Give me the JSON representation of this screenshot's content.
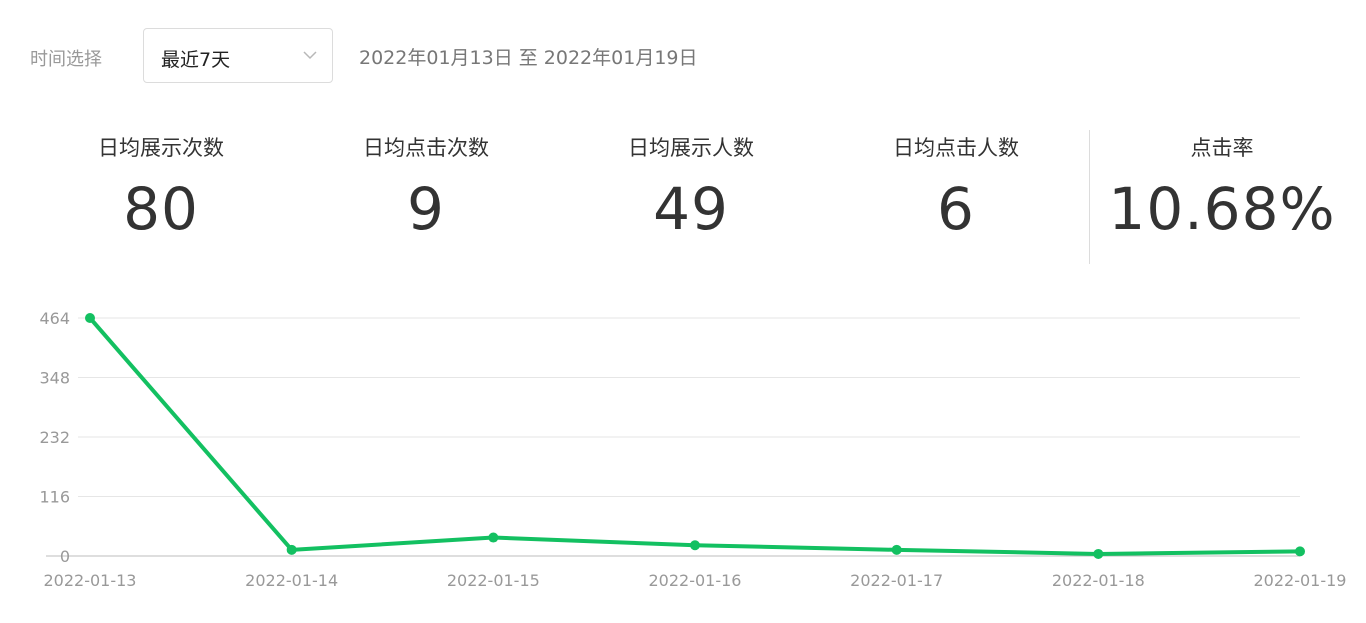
{
  "filter": {
    "label": "时间选择",
    "selected": "最近7天",
    "date_range": "2022年01月13日 至 2022年01月19日"
  },
  "stats": [
    {
      "label": "日均展示次数",
      "value": "80"
    },
    {
      "label": "日均点击次数",
      "value": "9"
    },
    {
      "label": "日均展示人数",
      "value": "49"
    },
    {
      "label": "日均点击人数",
      "value": "6"
    },
    {
      "label": "点击率",
      "value": "10.68%"
    }
  ],
  "colors": {
    "line": "#13c061",
    "grid": "#e6e6e6",
    "axis_text": "#999999"
  },
  "chart_data": {
    "type": "line",
    "x": [
      "2022-01-13",
      "2022-01-14",
      "2022-01-15",
      "2022-01-16",
      "2022-01-17",
      "2022-01-18",
      "2022-01-19"
    ],
    "series": [
      {
        "values": [
          464,
          12,
          36,
          21,
          12,
          4,
          9
        ]
      }
    ],
    "y_ticks": [
      "0",
      "116",
      "232",
      "348",
      "464"
    ],
    "ylim": [
      0,
      464
    ],
    "grid": true,
    "title": "",
    "xlabel": "",
    "ylabel": ""
  }
}
